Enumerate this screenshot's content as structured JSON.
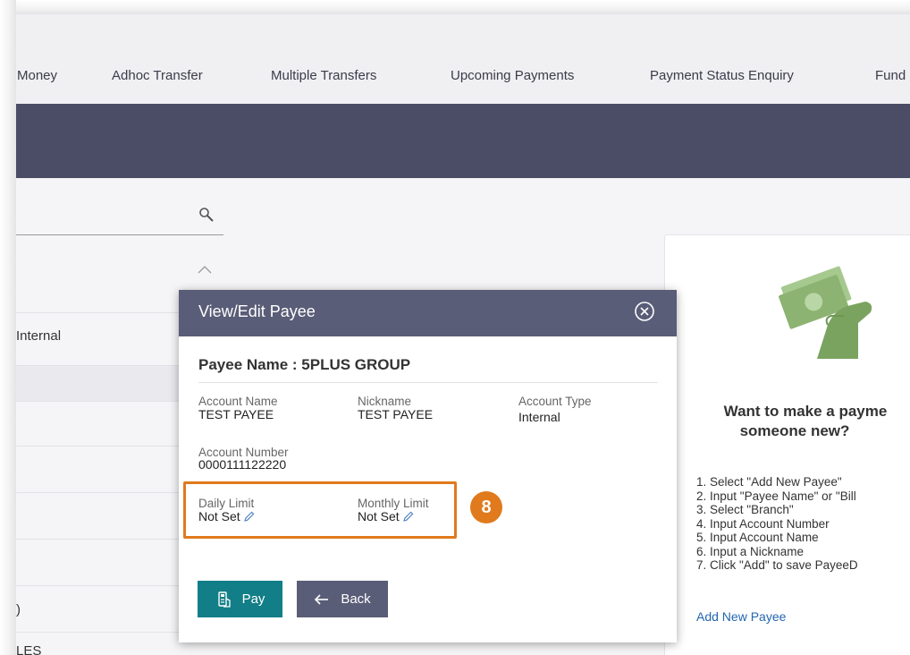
{
  "nav": {
    "items": [
      "Money",
      "Adhoc Transfer",
      "Multiple Transfers",
      "Upcoming Payments",
      "Payment Status Enquiry",
      "Fund"
    ]
  },
  "search": {
    "placeholder": ""
  },
  "list": {
    "rows": [
      "Internal",
      "",
      "",
      "",
      "",
      ")",
      "LES"
    ]
  },
  "right_card": {
    "heading_line1": "Want to make a payme",
    "heading_line2": "someone new?",
    "steps": [
      "1. Select \"Add New Payee\"",
      "2. Input \"Payee Name\" or \"Bill",
      "3. Select \"Branch\"",
      "4. Input Account Number",
      "5. Input Account Name",
      "6. Input a Nickname",
      "7. Click \"Add\" to save PayeeD"
    ],
    "add_new_link": "Add New Payee"
  },
  "modal": {
    "title": "View/Edit Payee",
    "payee_name": "Payee Name : 5PLUS GROUP",
    "fields": {
      "account_name": {
        "label": "Account Name",
        "value": "TEST PAYEE"
      },
      "nickname": {
        "label": "Nickname",
        "value": "TEST PAYEE"
      },
      "account_type": {
        "label": "Account Type",
        "value": "Internal"
      },
      "account_number": {
        "label": "Account Number",
        "value": "0000111122220"
      },
      "daily_limit": {
        "label": "Daily Limit",
        "value": "Not Set"
      },
      "monthly_limit": {
        "label": "Monthly Limit",
        "value": "Not Set"
      }
    },
    "buttons": {
      "pay": "Pay",
      "back": "Back"
    }
  },
  "callout": {
    "number": "8"
  },
  "colors": {
    "banner": "#4a4d65",
    "modal_header": "#5a5d77",
    "pay_button": "#127e87",
    "back_button": "#5a5d77",
    "highlight": "#e07a1c",
    "link": "#2366b0",
    "illustration_green": "#8cb371"
  }
}
